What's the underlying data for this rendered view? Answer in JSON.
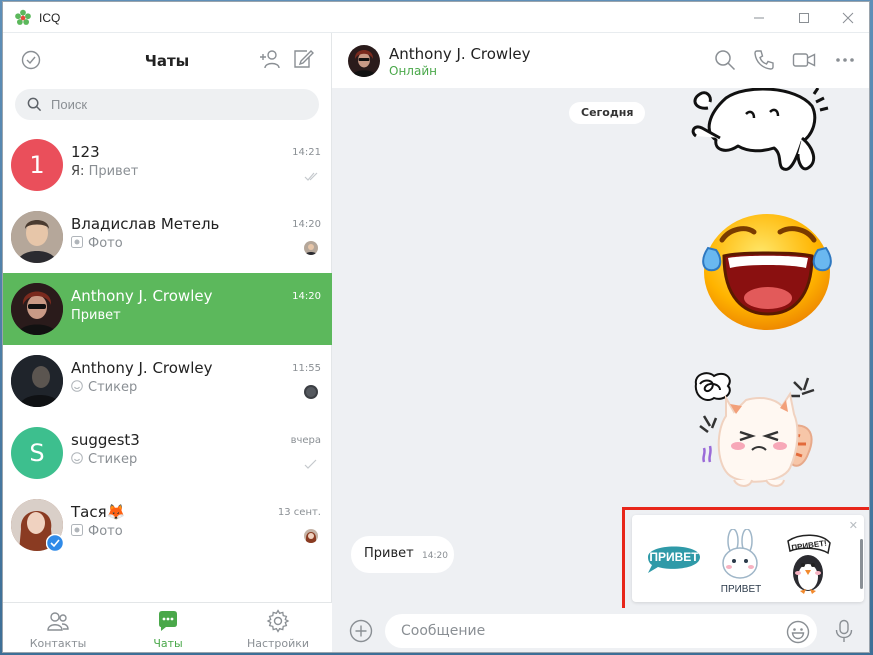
{
  "window": {
    "title": "ICQ"
  },
  "colors": {
    "accent": "#5cb85c",
    "online": "#4aa84a",
    "highlight": "#e8261a"
  },
  "left": {
    "title": "Чаты",
    "search_placeholder": "Поиск",
    "chats": [
      {
        "avatar_letter": "1",
        "avatar_color": "#ea4f5b",
        "name": "123",
        "prefix": "Я:",
        "preview": "Привет",
        "time": "14:21",
        "status_icon": "read-check-icon"
      },
      {
        "avatar_letter": "",
        "avatar_color": "#6b5b4e",
        "name": "Владислав Метель",
        "prefix": "",
        "preview": "Фото",
        "preview_icon": "photo-icon",
        "time": "14:20",
        "status_icon": "mini-avatar-icon"
      },
      {
        "avatar_letter": "",
        "avatar_color": "#3a2a2a",
        "name": "Anthony J. Crowley",
        "prefix": "",
        "preview": "Привет",
        "time": "14:20",
        "status_icon": ""
      },
      {
        "avatar_letter": "",
        "avatar_color": "#2e3440",
        "name": "Anthony J. Crowley",
        "prefix": "",
        "preview": "Стикер",
        "preview_icon": "sticker-icon",
        "time": "11:55",
        "status_icon": "mini-avatar-icon"
      },
      {
        "avatar_letter": "S",
        "avatar_color": "#3dbf8e",
        "name": "suggest3",
        "prefix": "",
        "preview": "Стикер",
        "preview_icon": "sticker-icon",
        "time": "вчера",
        "status_icon": "read-check-icon"
      },
      {
        "avatar_letter": "",
        "avatar_color": "#9c5b3e",
        "name": "Тася🦊",
        "prefix": "",
        "preview": "Фото",
        "preview_icon": "photo-icon",
        "time": "13 сент.",
        "status_icon": "mini-avatar-icon"
      }
    ],
    "nav": [
      {
        "label": "Контакты",
        "icon": "contacts-icon",
        "active": false
      },
      {
        "label": "Чаты",
        "icon": "chats-icon",
        "active": true
      },
      {
        "label": "Настройки",
        "icon": "settings-icon",
        "active": false
      }
    ]
  },
  "conversation": {
    "name": "Anthony J. Crowley",
    "status": "Онлайн",
    "date_divider": "Сегодня",
    "message": {
      "text": "Привет",
      "time": "14:20"
    },
    "stickers": [
      "sticker-cat-running",
      "sticker-laughing-emoji",
      "sticker-angry-cat"
    ],
    "suggestions": [
      {
        "label": "ПРИВЕТ",
        "icon": "sticker-privet-bubble"
      },
      {
        "label": "ПРИВЕТ",
        "icon": "sticker-privet-bunny"
      },
      {
        "label": "ПРИВЕТ!",
        "icon": "sticker-privet-penguin"
      }
    ],
    "composer_placeholder": "Сообщение"
  }
}
